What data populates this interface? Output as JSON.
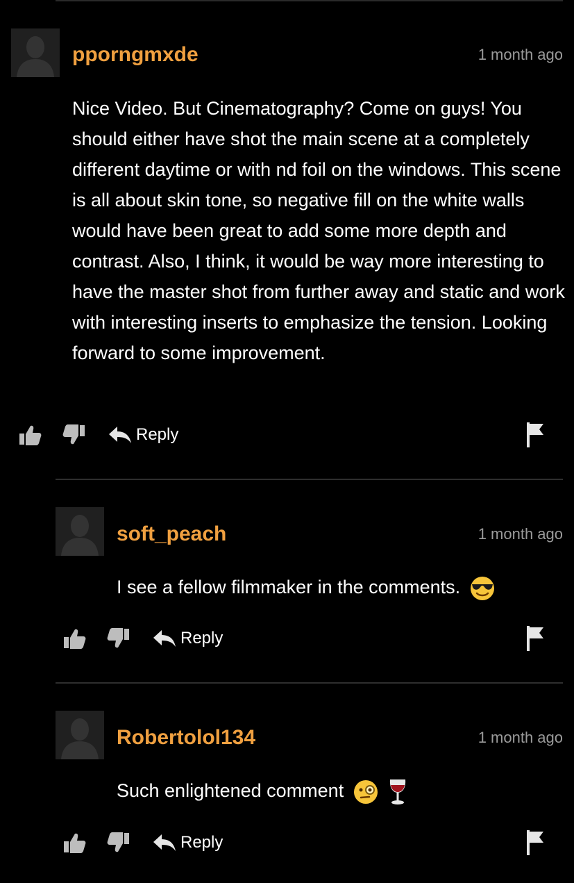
{
  "colors": {
    "username": "#f0a040",
    "background": "#000000",
    "timestamp": "#9a9a9a"
  },
  "comments": [
    {
      "username": "pporngmxde",
      "time": "1 month ago",
      "text": "Nice Video. But Cinematography? Come on guys! You should either have shot the main scene at a completely different daytime or with nd foil on the windows. This scene is all about skin tone, so negative fill on the white walls would have been great to add some more depth and contrast. Also, I think, it would be way more interesting to have the master shot from further away and static and work with interesting inserts to emphasize the tension. Looking forward to some improvement.",
      "reply_label": "Reply",
      "emojis": []
    },
    {
      "username": "soft_peach",
      "time": "1 month ago",
      "text": "I see a fellow filmmaker in the comments.",
      "reply_label": "Reply",
      "emojis": [
        "sunglasses-face-emoji"
      ]
    },
    {
      "username": "Robertolol134",
      "time": "1 month ago",
      "text": "Such enlightened comment",
      "reply_label": "Reply",
      "emojis": [
        "monocle-face-emoji",
        "wine-glass-emoji"
      ]
    }
  ],
  "icons": [
    "avatar-placeholder-icon",
    "thumbs-up-icon",
    "thumbs-down-icon",
    "reply-arrow-icon",
    "flag-icon"
  ]
}
